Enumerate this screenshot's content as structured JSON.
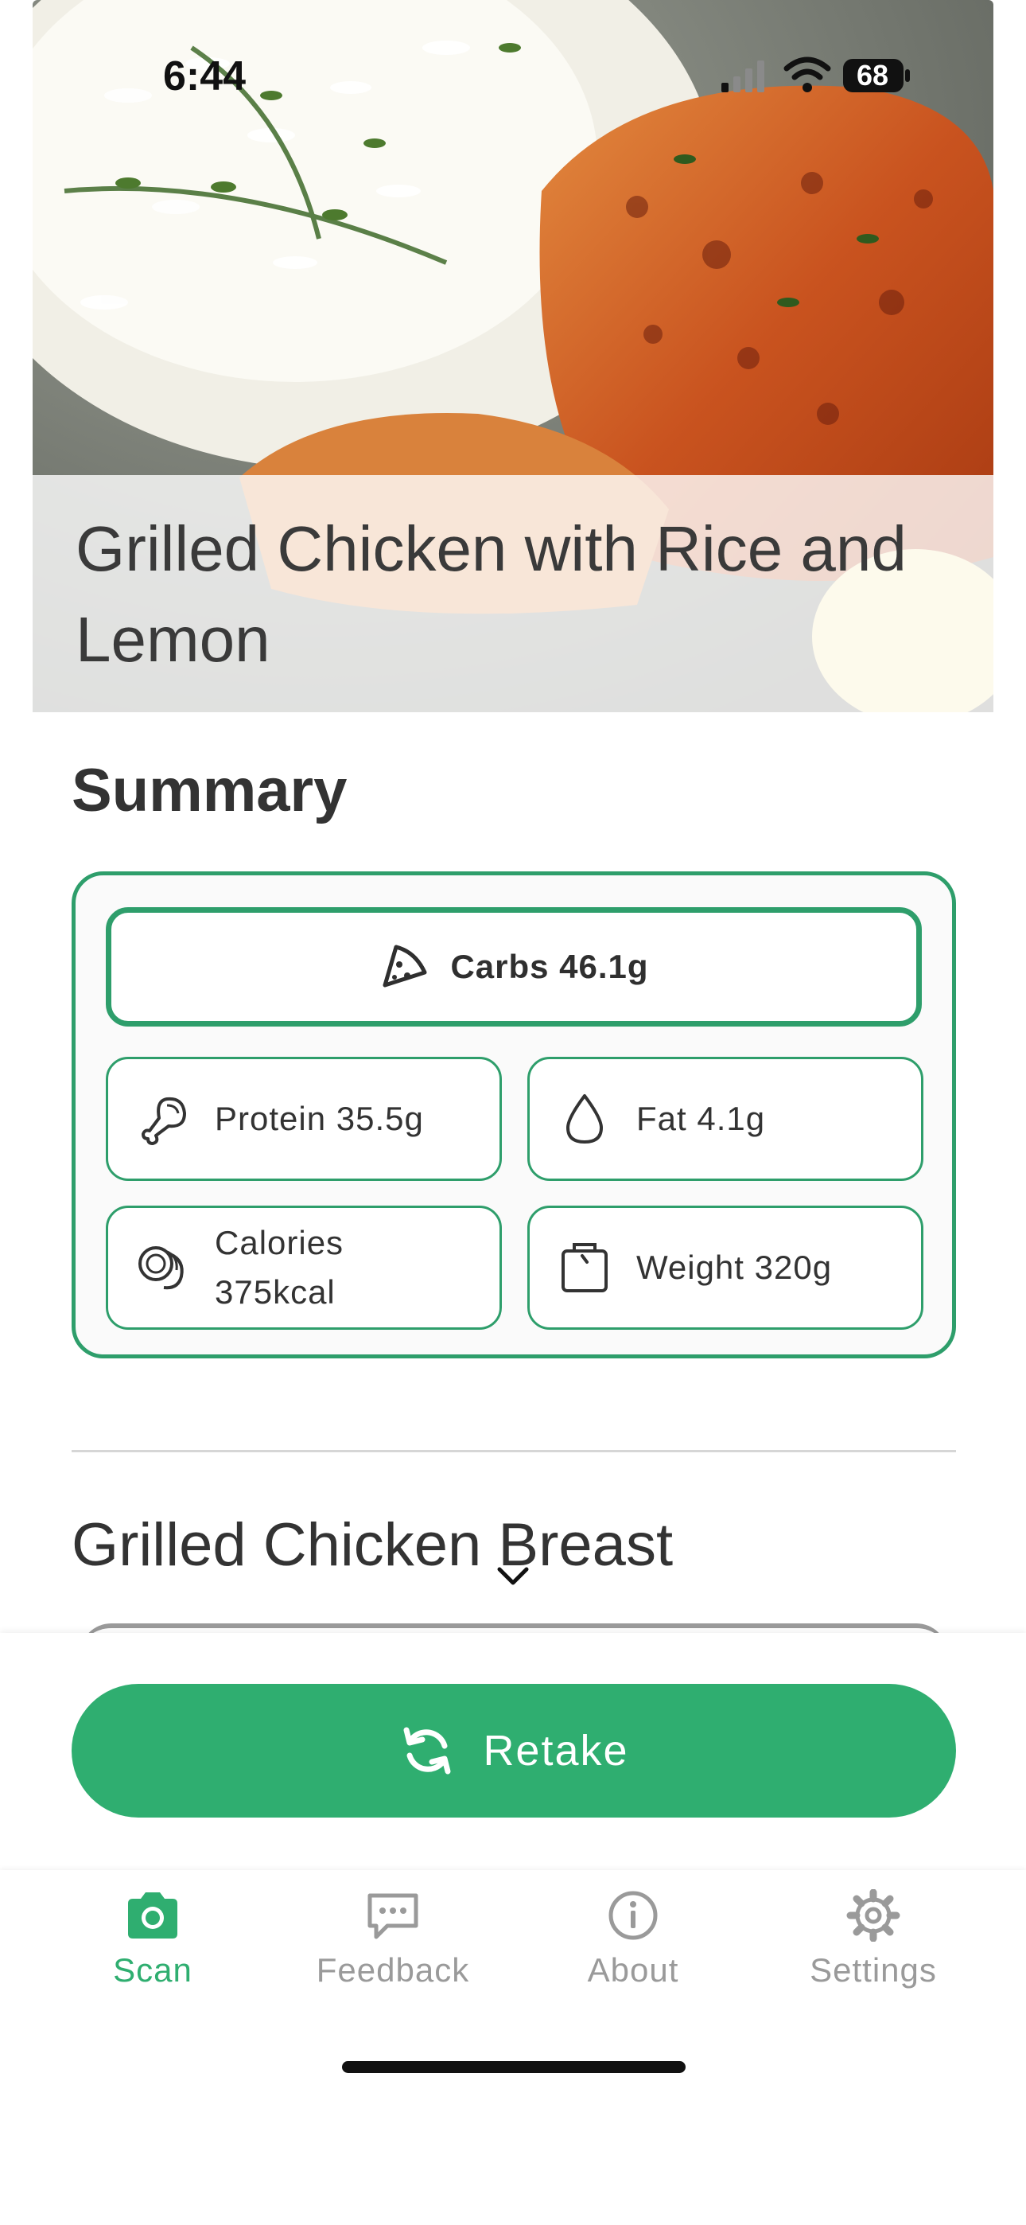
{
  "status_bar": {
    "time": "6:44",
    "battery": "68"
  },
  "hero": {
    "title": "Grilled Chicken with Rice and Lemon"
  },
  "summary": {
    "heading": "Summary",
    "carbs": "Carbs 46.1g",
    "protein": "Protein 35.5g",
    "fat": "Fat 4.1g",
    "calories_label": "Calories",
    "calories_value": "375kcal",
    "weight": "Weight 320g"
  },
  "items": {
    "first_item": "Grilled Chicken Breast"
  },
  "actions": {
    "retake_label": "Retake"
  },
  "tabs": [
    {
      "label": "Scan",
      "icon": "camera-icon",
      "active": true
    },
    {
      "label": "Feedback",
      "icon": "chat-icon",
      "active": false
    },
    {
      "label": "About",
      "icon": "info-icon",
      "active": false
    },
    {
      "label": "Settings",
      "icon": "gear-icon",
      "active": false
    }
  ],
  "colors": {
    "accent": "#2fae70",
    "border": "#2e9e6b",
    "inactive": "#9a9a9a"
  }
}
